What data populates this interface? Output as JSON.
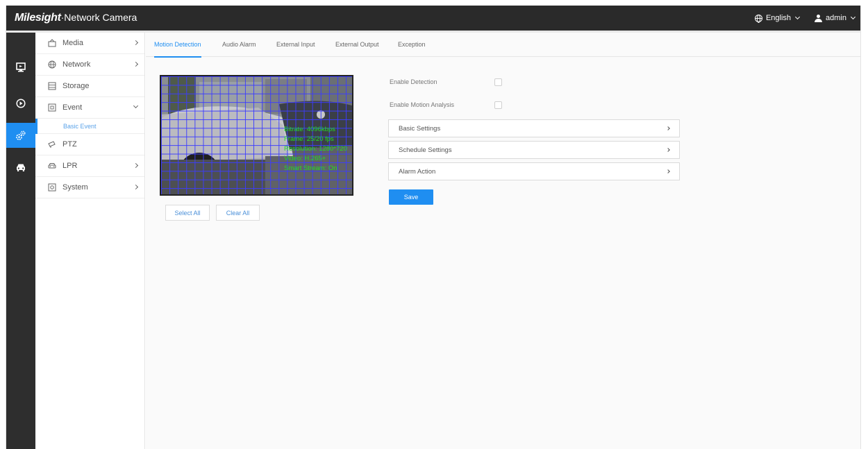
{
  "header": {
    "brand_mark": "Milesight",
    "brand_name": "·Network Camera",
    "language": "English",
    "user": "admin"
  },
  "rail": [
    {
      "icon": "monitor-icon"
    },
    {
      "icon": "playback-icon"
    },
    {
      "icon": "settings-gear-icon",
      "active": true
    },
    {
      "icon": "car-icon"
    }
  ],
  "sidebar": {
    "items": [
      {
        "label": "Media"
      },
      {
        "label": "Network"
      },
      {
        "label": "Storage"
      },
      {
        "label": "Event"
      },
      {
        "label": "Basic Event"
      },
      {
        "label": "PTZ"
      },
      {
        "label": "LPR"
      },
      {
        "label": "System"
      }
    ]
  },
  "tabs": [
    {
      "label": "Motion Detection",
      "active": true
    },
    {
      "label": "Audio Alarm"
    },
    {
      "label": "External Input"
    },
    {
      "label": "External Output"
    },
    {
      "label": "Exception"
    }
  ],
  "preview": {
    "osd_lines": [
      "Bitrate: 4096kbps",
      "Frame: 25/20 fps",
      "Resolution: 1280*720",
      "Video: H.265+",
      "Smart Stream: On"
    ]
  },
  "buttons": {
    "select_all": "Select All",
    "clear_all": "Clear All",
    "save": "Save"
  },
  "form": {
    "enable_detection": "Enable Detection",
    "enable_motion_analysis": "Enable Motion Analysis",
    "enable_detection_checked": false,
    "enable_motion_analysis_checked": false
  },
  "panels": {
    "basic_settings": "Basic Settings",
    "schedule_settings": "Schedule Settings",
    "alarm_action": "Alarm Action"
  },
  "colors": {
    "accent": "#1f8ef1",
    "topbar": "#2a2a2a",
    "rail": "#2e2e2e",
    "grid": "#3c3cff",
    "osd": "#22dd22"
  }
}
